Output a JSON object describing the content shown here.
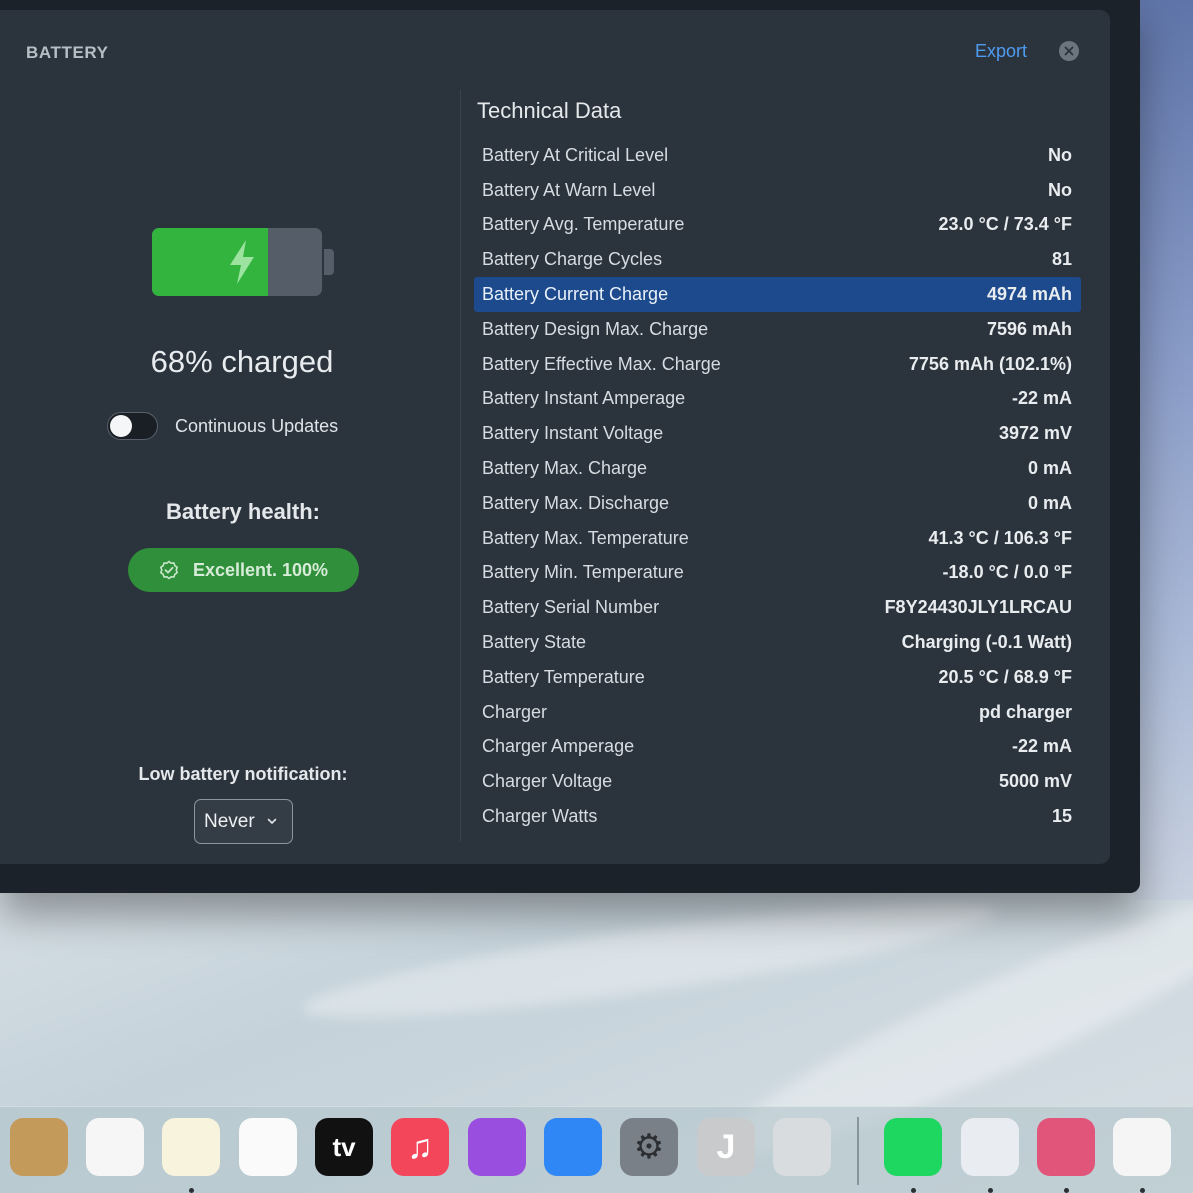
{
  "sheet": {
    "title": "BATTERY",
    "export_label": "Export"
  },
  "battery": {
    "charge_percent": 68,
    "charge_text": "68% charged",
    "fill_color": "#33b43f",
    "continuous_updates_label": "Continuous Updates",
    "continuous_updates_on": false,
    "health_title": "Battery health:",
    "health_badge": "Excellent. 100%",
    "notification_label": "Low battery notification:",
    "notification_value": "Never"
  },
  "technical": {
    "title": "Technical Data",
    "rows": [
      {
        "label": "Battery At Critical Level",
        "value": "No"
      },
      {
        "label": "Battery At Warn Level",
        "value": "No"
      },
      {
        "label": "Battery Avg. Temperature",
        "value": "23.0 °C / 73.4 °F"
      },
      {
        "label": "Battery Charge Cycles",
        "value": "81"
      },
      {
        "label": "Battery Current Charge",
        "value": "4974 mAh",
        "selected": true
      },
      {
        "label": "Battery Design Max. Charge",
        "value": "7596 mAh"
      },
      {
        "label": "Battery Effective Max. Charge",
        "value": "7756 mAh (102.1%)"
      },
      {
        "label": "Battery Instant Amperage",
        "value": "-22 mA"
      },
      {
        "label": "Battery Instant Voltage",
        "value": "3972 mV"
      },
      {
        "label": "Battery Max. Charge",
        "value": "0 mA"
      },
      {
        "label": "Battery Max. Discharge",
        "value": "0 mA"
      },
      {
        "label": "Battery Max. Temperature",
        "value": "41.3 °C / 106.3 °F"
      },
      {
        "label": "Battery Min. Temperature",
        "value": "-18.0 °C / 0.0 °F"
      },
      {
        "label": "Battery Serial Number",
        "value": "F8Y24430JLY1LRCAU"
      },
      {
        "label": "Battery State",
        "value": "Charging (-0.1 Watt)"
      },
      {
        "label": "Battery Temperature",
        "value": "20.5 °C / 68.9 °F"
      },
      {
        "label": "Charger",
        "value": "pd charger"
      },
      {
        "label": "Charger Amperage",
        "value": "-22 mA"
      },
      {
        "label": "Charger Voltage",
        "value": "5000 mV"
      },
      {
        "label": "Charger Watts",
        "value": "15"
      }
    ]
  },
  "dock": {
    "icons": [
      {
        "name": "contacts-icon",
        "glyph": "",
        "bg": "#c49a5a",
        "fg": "#7a5a30",
        "running": false
      },
      {
        "name": "reminders-icon",
        "glyph": "",
        "bg": "#f6f6f6",
        "fg": "#333333",
        "running": false
      },
      {
        "name": "notes-icon",
        "glyph": "",
        "bg": "#f8f3dc",
        "fg": "#f2c63d",
        "running": true
      },
      {
        "name": "freeform-icon",
        "glyph": "",
        "bg": "#fafafa",
        "fg": "#2f7bf0",
        "running": false
      },
      {
        "name": "apple-tv-icon",
        "glyph": "tv",
        "bg": "#111111",
        "fg": "#ffffff",
        "running": false
      },
      {
        "name": "music-icon",
        "glyph": "♫",
        "bg": "#f4465a",
        "fg": "#ffffff",
        "running": false
      },
      {
        "name": "podcasts-icon",
        "glyph": "",
        "bg": "#9a4ee0",
        "fg": "#ffffff",
        "running": false
      },
      {
        "name": "app-store-icon",
        "glyph": "",
        "bg": "#2f86f5",
        "fg": "#ffffff",
        "running": false
      },
      {
        "name": "system-settings-icon",
        "glyph": "⚙",
        "bg": "#7a8087",
        "fg": "#2b2e32",
        "running": false
      },
      {
        "name": "app-j-icon",
        "glyph": "J",
        "bg": "#c8cacc",
        "fg": "#ffffff",
        "running": false
      },
      {
        "name": "iphone-mirroring-icon",
        "glyph": "",
        "bg": "#d9dcdf",
        "fg": "#2a2e33",
        "running": false
      },
      {
        "name": "spotify-icon",
        "glyph": "",
        "bg": "#1ed760",
        "fg": "#111111",
        "running": true
      },
      {
        "name": "preview-icon",
        "glyph": "",
        "bg": "#e9edf1",
        "fg": "#4a6fa5",
        "running": true
      },
      {
        "name": "usb-app-icon",
        "glyph": "",
        "bg": "#e2557a",
        "fg": "#ffffff",
        "running": true
      },
      {
        "name": "textedit-icon",
        "glyph": "",
        "bg": "#f5f5f5",
        "fg": "#888888",
        "running": true
      }
    ]
  }
}
